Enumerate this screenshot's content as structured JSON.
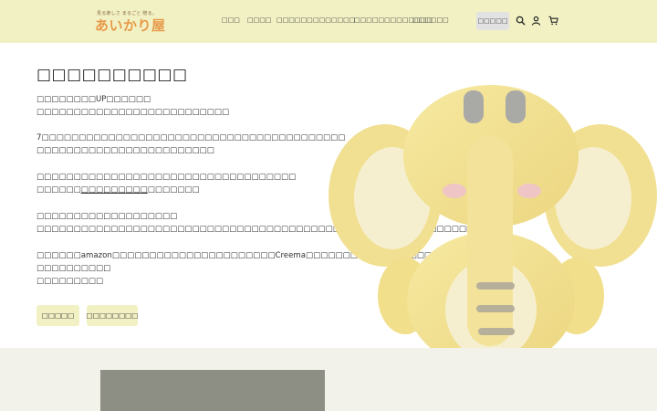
{
  "header": {
    "logo_tagline": "見る楽しさ まるごと 贈る。",
    "logo_text": "あいかり屋",
    "nav": [
      {
        "label": "□□□"
      },
      {
        "label": "□□□□"
      },
      {
        "label": "□□□□□□"
      },
      {
        "label": "□□□□□□□"
      },
      {
        "label": "□□□□□□□□□□□□□"
      },
      {
        "label": "□□□□□□"
      }
    ],
    "login_label": "□□□□□",
    "icons": [
      "search-icon",
      "user-icon",
      "cart-icon"
    ]
  },
  "hero": {
    "title": "□□□□□□□□□□",
    "lines": [
      "□□□□□□□□UP□□□□□□",
      "□□□□□□□□□□□□□□□□□□□□□□□□□□",
      "7□□□□□□□□□□□□□□□□□□□□□□□□□□□□□□□□□□□□□□□□□",
      "□□□□□□□□□□□□□□□□□□□□□□□□",
      "□□□□□□□□□□□□□□□□□□□□□□□□□□□□□□□□□□□",
      "□□□□□□□□□□□□□□□□□□□",
      "□□□□□□□□□□□□□□□□□□□□□□□□□□□□□□□□□□□□□□□□□□□□□□□□□□□□□□□□□□□□□□□□",
      "□□□□□□amazon□□□□□□□□□□□□□□□□□□□□□□Creema□□□□□□□□□□□□□□□□□□□",
      "□□□□□□□□□□",
      "□□□□□□□□□"
    ],
    "line_link": {
      "before": "□□□□□□",
      "link": "□□□□□□□□□",
      "after": "□□□□□□□"
    },
    "line_link_2": "□□□□□□□□□□□□□□□□□□□",
    "buttons": [
      {
        "label": "□□□□□"
      },
      {
        "label": "□□□□□□□□"
      }
    ]
  },
  "colors": {
    "header_bg": "#f2f1c4",
    "button_bg": "#f2f1c4",
    "lower_bg": "#f2f1ea",
    "gray_block": "#8d8e84",
    "logo_orange": "#e79a4a"
  }
}
